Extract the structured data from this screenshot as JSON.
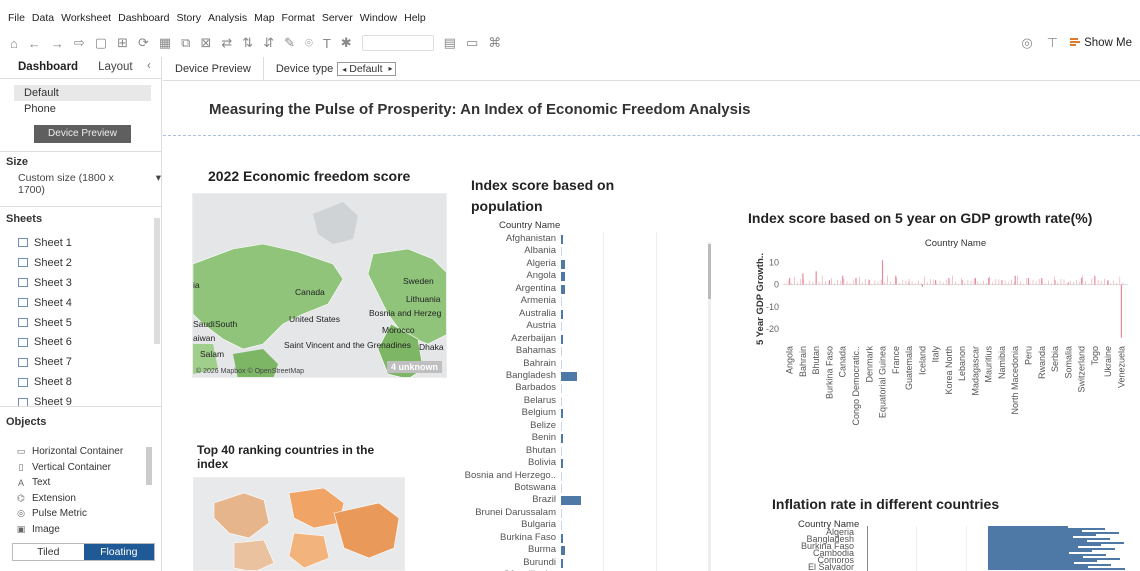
{
  "menu": [
    "File",
    "Data",
    "Worksheet",
    "Dashboard",
    "Story",
    "Analysis",
    "Map",
    "Format",
    "Server",
    "Window",
    "Help"
  ],
  "toolbar": {
    "show_me": "Show Me"
  },
  "left_panel": {
    "tabs": {
      "dashboard": "Dashboard",
      "layout": "Layout"
    },
    "devices": [
      "Default",
      "Phone"
    ],
    "device_preview_button": "Device Preview",
    "size": {
      "title": "Size",
      "value": "Custom size (1800 x 1700)"
    },
    "sheets": {
      "title": "Sheets",
      "items": [
        "Sheet 1",
        "Sheet 2",
        "Sheet 3",
        "Sheet 4",
        "Sheet 5",
        "Sheet 6",
        "Sheet 7",
        "Sheet 8",
        "Sheet 9"
      ]
    },
    "objects": {
      "title": "Objects",
      "items": [
        "Horizontal Container",
        "Vertical Container",
        "Text",
        "Extension",
        "Pulse Metric",
        "Image"
      ]
    },
    "layout_mode": {
      "tiled": "Tiled",
      "floating": "Floating",
      "selected": "Floating"
    }
  },
  "device_bar": {
    "preview_tab": "Device Preview",
    "device_type_label": "Device type",
    "device_type_value": "Default"
  },
  "dashboard": {
    "title": "Measuring the Pulse of Prosperity: An Index of Economic Freedom Analysis",
    "map1": {
      "title": "2022 Economic freedom score",
      "labels": [
        "Sweden",
        "Lithuania",
        "Canada",
        "United States",
        "Bosnia and Herzeg",
        "Morocco",
        "Saint Vincent and the Grenadines",
        "Dhaka",
        "Saudi",
        "South",
        "aiwan",
        "Salam",
        "ia"
      ],
      "credit": "© 2026 Mapbox © OpenStreetMap",
      "unknown": "4 unknown"
    },
    "map2": {
      "title": "Top 40 ranking countries in the index"
    },
    "population": {
      "title": "Index score based on population",
      "header": "Country Name",
      "countries": [
        "Afghanistan",
        "Albania",
        "Algeria",
        "Angola",
        "Argentina",
        "Armenia",
        "Australia",
        "Austria",
        "Azerbaijan",
        "Bahamas",
        "Bahrain",
        "Bangladesh",
        "Barbados",
        "Belarus",
        "Belgium",
        "Belize",
        "Benin",
        "Bhutan",
        "Bolivia",
        "Bosnia and Herzego..",
        "Botswana",
        "Brazil",
        "Brunei Darussalam",
        "Bulgaria",
        "Burkina Faso",
        "Burma",
        "Burundi",
        "Côte d'Ivoire"
      ],
      "values": [
        2,
        0,
        3,
        3,
        3,
        0,
        2,
        0,
        1,
        0,
        0,
        14,
        0,
        0,
        1,
        0,
        1,
        0,
        1,
        0,
        0,
        17,
        0,
        0,
        1,
        3,
        1,
        2
      ]
    },
    "gdp": {
      "title": "Index score based on 5 year on GDP growth rate(%)",
      "chart_data": {
        "type": "bar",
        "title": "Country Name",
        "xlabel": "",
        "ylabel": "5 Year GDP Growth..",
        "ylim": [
          -25,
          12
        ],
        "yticks": [
          10,
          0,
          -10,
          -20
        ],
        "categories": [
          "Angola",
          "Bahrain",
          "Bhutan",
          "Burkina Faso",
          "Canada",
          "Congo Democratic..",
          "Denmark",
          "Equatorial Guinea",
          "France",
          "Guatemala",
          "Iceland",
          "Italy",
          "Korea North",
          "Lebanon",
          "Madagascar",
          "Mauritius",
          "Namibia",
          "North Macedonia",
          "Peru",
          "Rwanda",
          "Serbia",
          "Somalia",
          "Switzerland",
          "Togo",
          "Ukraine",
          "Venezuela"
        ],
        "values": [
          3,
          5,
          6,
          2,
          4,
          3,
          2,
          11,
          4,
          1,
          -1,
          2,
          3,
          2,
          3,
          3,
          2,
          4,
          3,
          3,
          2,
          1,
          3,
          4,
          2,
          -24
        ],
        "color": "#e78a9c"
      }
    },
    "inflation": {
      "title": "Inflation rate in different countries",
      "header": "Country Name",
      "rows": [
        "Algeria",
        "Bangladesh",
        "Burkina Faso",
        "Cambodia",
        "Comoros",
        "El Salvador"
      ]
    }
  }
}
